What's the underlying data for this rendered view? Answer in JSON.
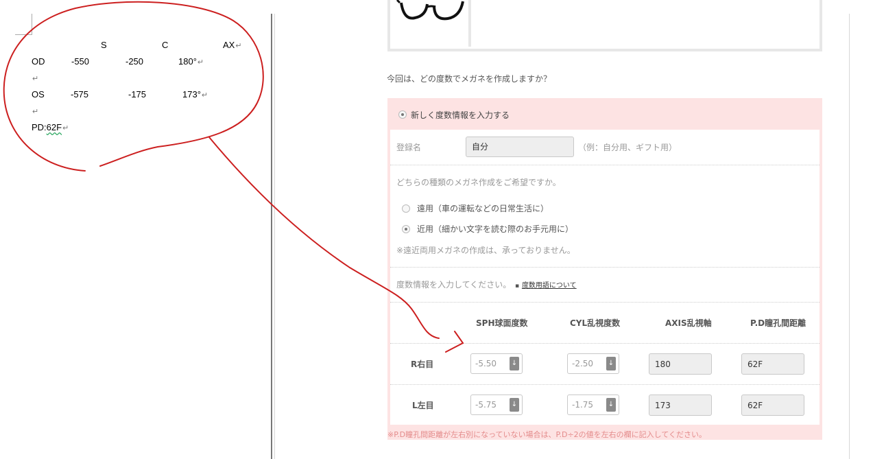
{
  "doc": {
    "header": {
      "s": "S",
      "c": "C",
      "ax": "AX"
    },
    "od": {
      "label": "OD",
      "s": "-550",
      "c": "-250",
      "ax": "180°"
    },
    "os": {
      "label": "OS",
      "s": "-575",
      "c": "-175",
      "ax": "173°"
    },
    "pd_label": "PD:",
    "pd_value": "62F",
    "para_mark": "↵"
  },
  "form": {
    "question": "今回は、どの度数でメガネを作成しますか？",
    "new_option": "新しく度数情報を入力する",
    "registration": {
      "label": "登録名",
      "value": "自分",
      "hint": "（例：自分用、ギフト用）"
    },
    "type_question": "どちらの種類のメガネ作成をご希望ですか。",
    "options": [
      {
        "label": "遠用（車の運転などの日常生活に）",
        "selected": false
      },
      {
        "label": "近用（細かい文字を読む際のお手元用に）",
        "selected": true
      }
    ],
    "bifocal_note": "※遠近両用メガネの作成は、承っておりません。",
    "prescription_prompt": "度数情報を入力してください。",
    "terms_link": "度数用語について",
    "columns": [
      "SPH球面度数",
      "CYL乱視度数",
      "AXIS乱視軸",
      "P.D瞳孔間距離"
    ],
    "rows": [
      {
        "label": "R右目",
        "sph": "-5.50",
        "cyl": "-2.50",
        "axis": "180",
        "pd": "62F"
      },
      {
        "label": "L左目",
        "sph": "-5.75",
        "cyl": "-1.75",
        "axis": "173",
        "pd": "62F"
      }
    ],
    "footer_note": "※P.D瞳孔間距離が左右別になっていない場合は、P.D÷2の値を左右の欄に記入してください。"
  },
  "colors": {
    "annotation": "#cc1f1f",
    "pink": "#fde3e3",
    "note": "#e48b8b"
  }
}
